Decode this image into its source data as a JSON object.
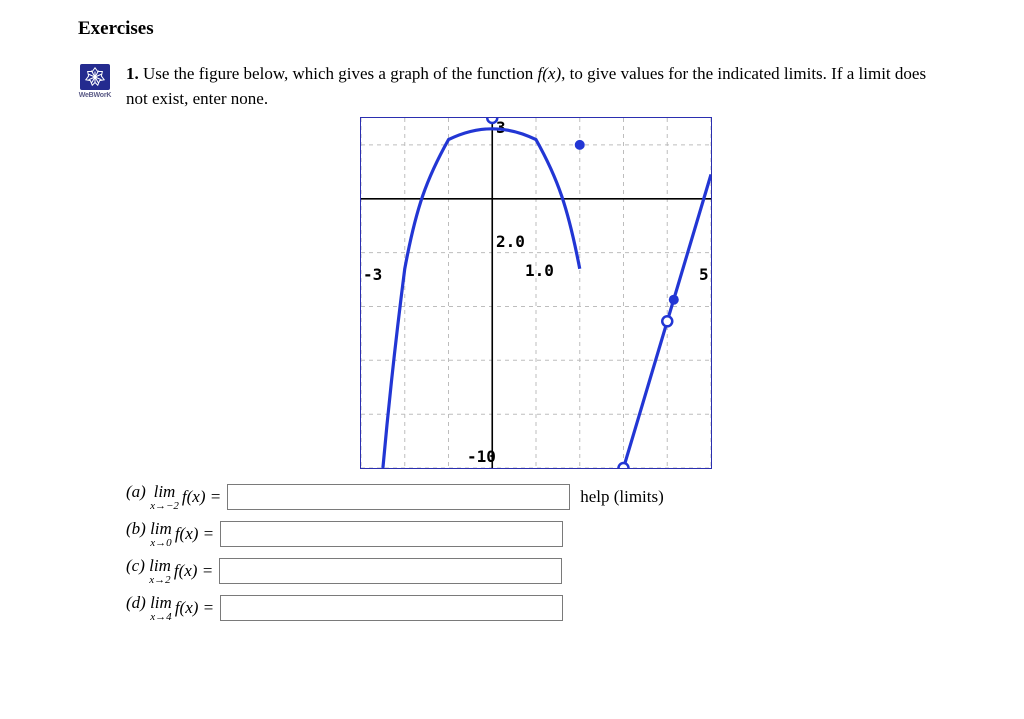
{
  "section_title": "Exercises",
  "webwork_label": "WeBWorK",
  "question": {
    "num": "1.",
    "prompt_before_fx": "Use the figure below, which gives a graph of the function ",
    "fx": "f(x)",
    "prompt_after_fx": ", to give values for the indicated limits. If a limit does not exist, enter none."
  },
  "chart_data": {
    "type": "line",
    "title": "",
    "xlabel": "",
    "ylabel": "",
    "xlim": [
      -3,
      5
    ],
    "ylim": [
      -10,
      3
    ],
    "xtick_labels": [
      "-3",
      "1.0",
      "5"
    ],
    "ytick_label_upper": "2.0",
    "ytick_label_lower": "-10",
    "top_axis_label": "3",
    "grid": true,
    "series": [
      {
        "name": "left-branch",
        "points": [
          [
            -2.5,
            -10
          ],
          [
            -2.0,
            -2.6
          ],
          [
            -1.5,
            0.75
          ],
          [
            -1.0,
            2.2
          ],
          [
            0.0,
            3.0
          ],
          [
            1.0,
            2.2
          ],
          [
            1.5,
            0.75
          ],
          [
            2.0,
            -2.6
          ]
        ],
        "open_points": [
          [
            0,
            3
          ]
        ],
        "closed_points": [
          [
            2,
            2
          ]
        ]
      },
      {
        "name": "right-branch",
        "points": [
          [
            3,
            -10
          ],
          [
            5,
            0.9
          ]
        ],
        "open_points": [
          [
            3,
            -10
          ],
          [
            4,
            -4.55
          ]
        ],
        "closed_points": [
          [
            4.15,
            -3.75
          ]
        ]
      }
    ]
  },
  "parts": [
    {
      "letter": "(a)",
      "limit_sub": "x→−2",
      "help": "help (limits)"
    },
    {
      "letter": "(b)",
      "limit_sub": "x→0"
    },
    {
      "letter": "(c)",
      "limit_sub": "x→2"
    },
    {
      "letter": "(d)",
      "limit_sub": "x→4"
    }
  ],
  "lim_word": "lim",
  "fx_expr": "f(x) ="
}
